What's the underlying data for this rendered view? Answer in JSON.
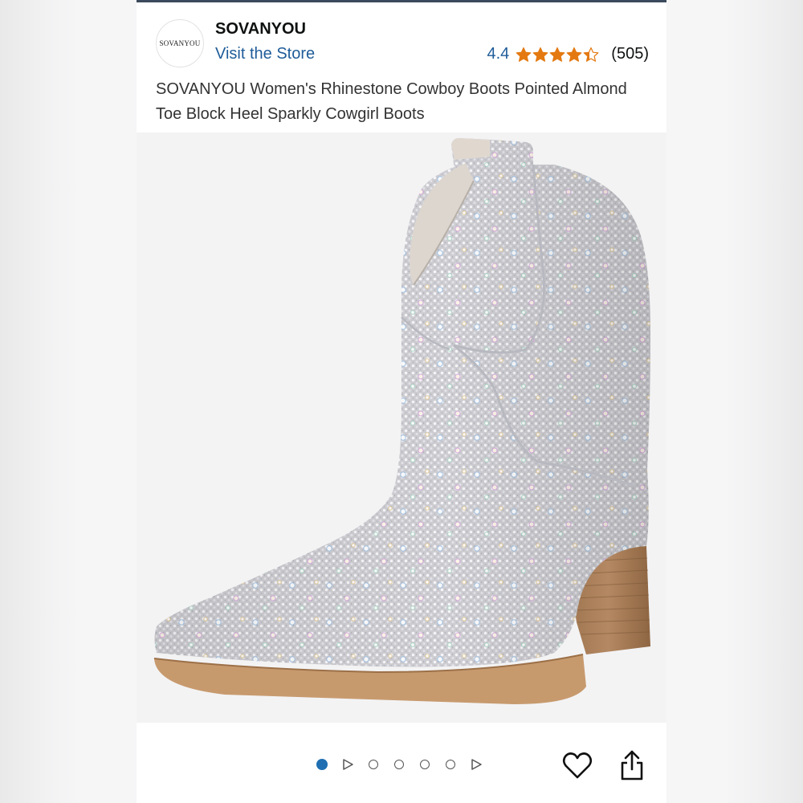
{
  "brand": {
    "logo_text": "SOVANYOU",
    "name": "SOVANYOU",
    "store_link": "Visit the Store"
  },
  "rating": {
    "value": "4.4",
    "stars": 4.4,
    "count": "(505)",
    "star_color": "#e47911"
  },
  "product": {
    "title": "SOVANYOU Women's Rhinestone Cowboy Boots Pointed Almond Toe Block Heel Sparkly Cowgirl Boots"
  },
  "gallery": {
    "items": [
      "dot-active",
      "play",
      "dot",
      "dot",
      "dot",
      "dot",
      "play"
    ],
    "active_index": 0,
    "active_color": "#1f6fb2"
  },
  "actions": {
    "favorite_icon": "heart-icon",
    "share_icon": "share-icon"
  }
}
